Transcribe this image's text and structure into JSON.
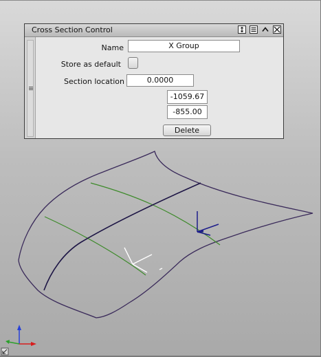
{
  "panel": {
    "title": "Cross Section Control",
    "titlebar_icons": [
      "resize-vertical-icon",
      "menu-icon",
      "collapse-icon",
      "close-icon"
    ]
  },
  "form": {
    "name_label": "Name",
    "name_value": "X Group",
    "store_default_label": "Store as default",
    "store_default_checked": false,
    "section_location_label": "Section location",
    "section_location_value": "0.0000",
    "coord_1": "-1059.67",
    "coord_2": "-855.00",
    "delete_label": "Delete"
  },
  "viewport": {
    "axis_icon": "xyz-axis-triad-icon",
    "corner_icon": "viewport-resize-corner-icon",
    "colors": {
      "surface_outline": "#3a2a5a",
      "section_curve": "#3d8a2a",
      "axis_x": "#d81c1c",
      "axis_y": "#2aa02a",
      "axis_z": "#2640d8",
      "manipulator": "#ffffff",
      "manipulator_dark": "#1c1c8a"
    }
  }
}
